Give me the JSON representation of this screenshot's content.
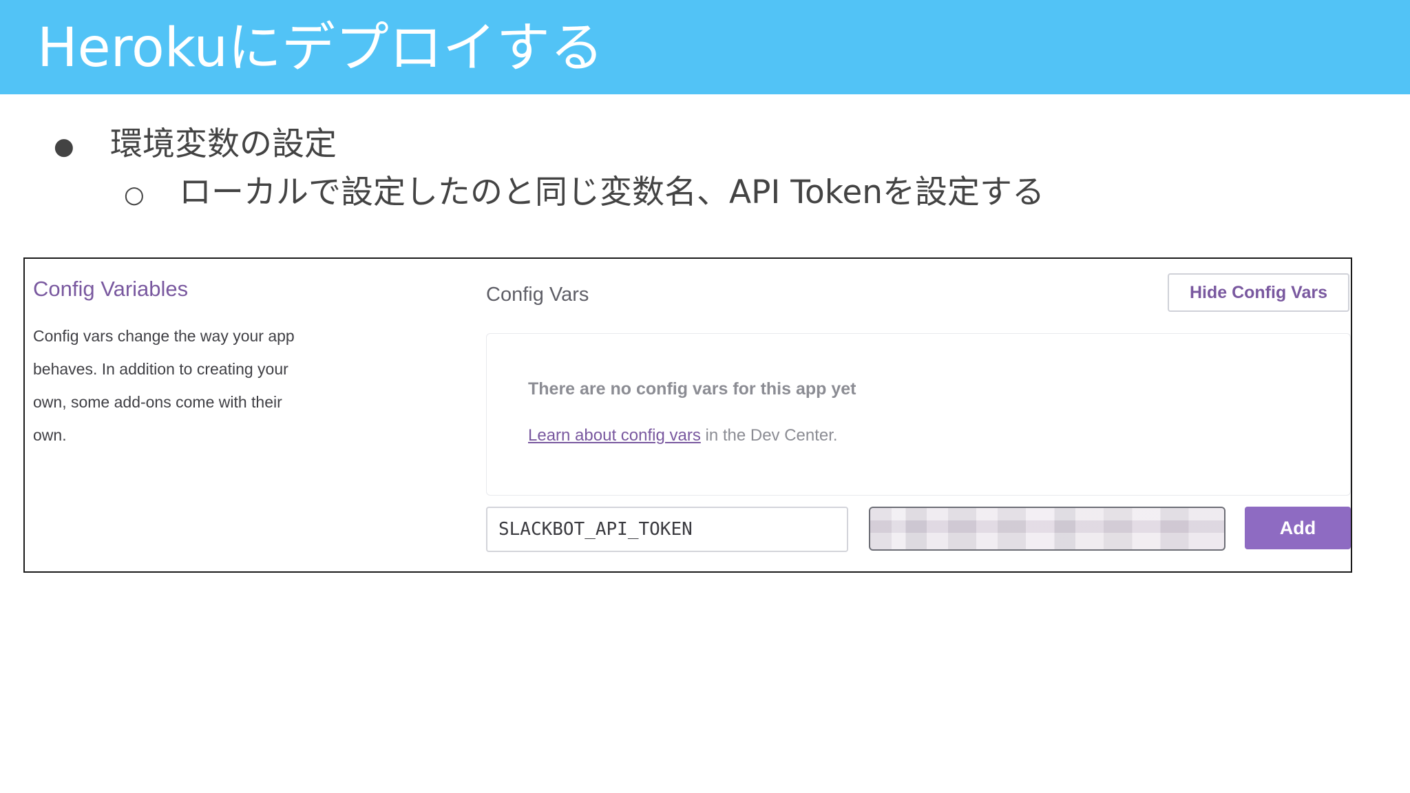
{
  "slide": {
    "title": "Herokuにデプロイする",
    "bullet_level1": "環境変数の設定",
    "bullet_level2": "ローカルで設定したのと同じ変数名、API Tokenを設定する",
    "bullet_marker_1": "●",
    "bullet_marker_2": "○"
  },
  "screenshot": {
    "section_heading": "Config Variables",
    "section_description_lines": [
      "Config vars change the way your app",
      "behaves. In addition to creating your",
      "own, some add-ons come with their",
      "own."
    ],
    "config_vars_heading": "Config Vars",
    "hide_button_label": "Hide Config Vars",
    "empty_message": "There are no config vars for this app yet",
    "learn_link_text": "Learn about config vars",
    "learn_suffix": " in the Dev Center.",
    "key_input_value": "SLACKBOT_API_TOKEN",
    "add_button_label": "Add"
  },
  "colors": {
    "title_bar": "#52c3f6",
    "heroku_purple": "#79589f",
    "add_button": "#8e6bc2"
  }
}
